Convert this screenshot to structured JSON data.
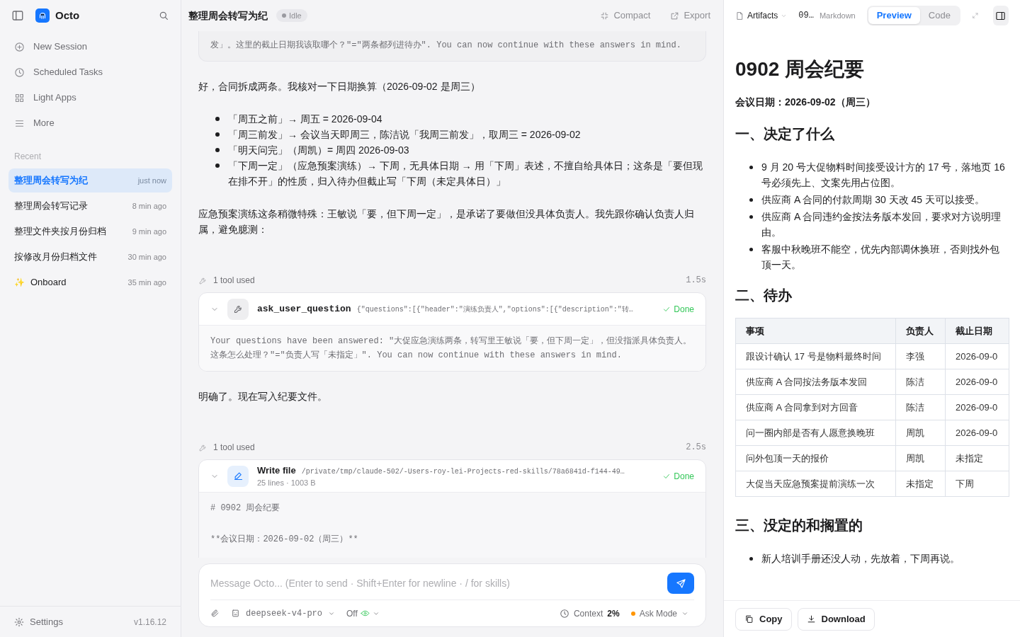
{
  "sidebar": {
    "app_name": "Octo",
    "nav": [
      {
        "kind": "plus",
        "label": "New Session"
      },
      {
        "kind": "clock",
        "label": "Scheduled Tasks"
      },
      {
        "kind": "grid",
        "label": "Light Apps"
      },
      {
        "kind": "menu",
        "label": "More"
      }
    ],
    "recent_heading": "Recent",
    "sessions": [
      {
        "title": "整理周会转写为纪",
        "time": "just now",
        "selected": true
      },
      {
        "title": "整理周会转写记录",
        "time": "8 min ago",
        "selected": false
      },
      {
        "title": "整理文件夹按月份归档",
        "time": "9 min ago",
        "selected": false
      },
      {
        "title": "按修改月份归档文件",
        "time": "30 min ago",
        "selected": false
      },
      {
        "title": "Onboard",
        "time": "35 min ago",
        "selected": false,
        "sparkle": "✨"
      }
    ],
    "settings": "Settings",
    "version": "v1.16.12"
  },
  "chat": {
    "title": "整理周会转写为纪",
    "status": "Idle",
    "actions": [
      "Compact",
      "Export"
    ],
    "messages": [
      {
        "kind": "result_tail",
        "text": "发」。这里的截止日期我该取哪个？\"=\"两条都列进待办\". You can now continue with these answers in mind."
      },
      {
        "kind": "text",
        "text": "好，合同拆成两条。我核对一下日期换算（2026-09-02 是周三）"
      },
      {
        "kind": "list",
        "items": [
          "「周五之前」→ 周五 = 2026-09-04",
          "「周三前发」→ 会议当天即周三，陈洁说「我周三前发」，取周三 = 2026-09-02",
          "「明天问完」（周凯）= 周四 2026-09-03",
          "「下周一定」（应急预案演练）→ 下周，无具体日期 → 用「下周」表述，不擅自给具体日；这条是「要但现在排不开」的性质，归入待办但截止写「下周（未定具体日）」"
        ]
      },
      {
        "kind": "text",
        "text": "应急预案演练这条稍微特殊：王敏说「要，但下周一定」，是承诺了要做但没具体负责人。我先跟你确认负责人归属，避免臆测："
      },
      {
        "kind": "tool_question",
        "summary": "1 tool used",
        "duration": "1.5s",
        "name": "ask_user_question",
        "args": "{\"questions\":[{\"header\":\"演练负责人\",\"options\":[{\"description\":\"转…",
        "status": "Done",
        "body": [
          {
            "text": "Your questions have been answered: \"大促应急演练两条，转写里王敏说「要，但下周一定」，但没指派具体负责人。"
          },
          {
            "text": "这条怎么处理？\"=\"负责人写「未指定」\". You can now continue with these answers in mind."
          }
        ]
      },
      {
        "kind": "text",
        "text": "明确了。现在写入纪要文件。"
      },
      {
        "kind": "tool_write",
        "summary": "1 tool used",
        "duration": "2.5s",
        "name": "Write file",
        "args": "/private/tmp/claude-502/-Users-roy-lei-Projects-red-skills/78a6841d-f144-49…",
        "meta": "25 lines · 1003 B",
        "status": "Done",
        "body": [
          {
            "text": "# 0902 周会纪要"
          },
          {
            "text": "**会议日期：2026-09-02（周三）**",
            "gap_before": true
          }
        ]
      }
    ],
    "composer": {
      "placeholder": "Message Octo... (Enter to send · Shift+Enter for newline · / for skills)",
      "model": "deepseek-v4-pro",
      "thinking": "Off",
      "context_label": "Context",
      "context_value": "2%",
      "mode": "Ask Mode"
    }
  },
  "artifact": {
    "menu": "Artifacts",
    "file": "09…",
    "format": "Markdown",
    "tabs": [
      {
        "label": "Preview",
        "selected": true
      },
      {
        "label": "Code",
        "selected": false
      }
    ],
    "doc": [
      {
        "kind": "h1",
        "text": "0902 周会纪要"
      },
      {
        "kind": "strong",
        "text": "会议日期：2026-09-02（周三）"
      },
      {
        "kind": "h2",
        "text": "一、决定了什么"
      },
      {
        "kind": "list",
        "items": [
          "9 月 20 号大促物料时间接受设计方的 17 号，落地页 16 号必须先上、文案先用占位图。",
          "供应商 A 合同的付款周期 30 天改 45 天可以接受。",
          "供应商 A 合同违约金按法务版本发回，要求对方说明理由。",
          "客服中秋晚班不能空，优先内部调休换班，否则找外包顶一天。"
        ]
      },
      {
        "kind": "h2",
        "text": "二、待办"
      },
      {
        "kind": "table",
        "columns": [
          "事项",
          "负责人",
          "截止日期"
        ],
        "rows": [
          [
            "跟设计确认 17 号是物料最终时间",
            "李强",
            "2026-09-0"
          ],
          [
            "供应商 A 合同按法务版本发回",
            "陈洁",
            "2026-09-0"
          ],
          [
            "供应商 A 合同拿到对方回音",
            "陈洁",
            "2026-09-0"
          ],
          [
            "问一圈内部是否有人愿意换晚班",
            "周凯",
            "2026-09-0"
          ],
          [
            "问外包顶一天的报价",
            "周凯",
            "未指定"
          ],
          [
            "大促当天应急预案提前演练一次",
            "未指定",
            "下周"
          ]
        ]
      },
      {
        "kind": "h2",
        "text": "三、没定的和搁置的"
      },
      {
        "kind": "list",
        "items": [
          "新人培训手册还没人动，先放着，下周再说。"
        ]
      }
    ],
    "buttons": [
      {
        "kind": "copy",
        "label": "Copy"
      },
      {
        "kind": "download",
        "label": "Download"
      }
    ]
  }
}
